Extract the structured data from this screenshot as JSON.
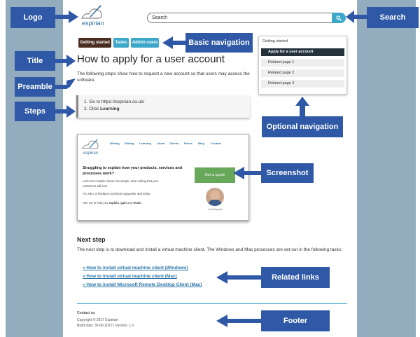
{
  "annotations": {
    "logo": "Logo",
    "search": "Search",
    "basic_nav": "Basic navigation",
    "title": "Title",
    "preamble": "Preamble",
    "steps": "Steps",
    "optional_nav": "Optional navigation",
    "screenshot": "Screenshot",
    "related_links": "Related links",
    "footer": "Footer"
  },
  "brand": {
    "name": "espirian"
  },
  "search": {
    "placeholder": "Search"
  },
  "nav": {
    "getting_started": "Getting started",
    "tasks": "Tasks",
    "admin_users": "Admin users"
  },
  "page": {
    "title": "How to apply for a user account",
    "preamble": "The following steps show how to request a new account so that users may access the software.",
    "steps": [
      "1. Go to https://espirian.co.uk/",
      "2. Click "
    ],
    "step2_bold": "Learning"
  },
  "sidebar": {
    "heading": "Getting started",
    "items": [
      "Apply for a user account",
      "Related page 1",
      "Related page 2",
      "Related page 3"
    ]
  },
  "shot": {
    "nav": [
      "Writing",
      "Editing",
      "Learning",
      "About",
      "Clients",
      "Prices",
      "Blog",
      "Contact"
    ],
    "heading": "Struggling to explain how your products, services and processes work?",
    "p1": "Let's turn complex ideas into simple, clear writing that your customers will love.",
    "p2": "I'm John, a freelance technical copywriter and editor.",
    "p3a": "Hire me to help you ",
    "explain": "explain",
    "comma": ", ",
    "gain": "gain",
    "and": " and ",
    "retain": "retain",
    "dot": ".",
    "button": "Get a quote",
    "caption": "John Espirian"
  },
  "next": {
    "heading": "Next step",
    "text": "The next step is to download and install a virtual machine client. The Windows and Mac processes are set out in the following tasks:",
    "links": [
      "» How to install virtual machine client (Windows)",
      "» How to install virtual machine client (Mac)",
      "» How to install Microsoft Remote Desktop Client (Mac)"
    ]
  },
  "footer": {
    "contact": "Contact us",
    "copyright": "Copyright © 2017 Espirian",
    "build": "Build date: 30-06-2017 | Version: 1.0"
  },
  "colors": {
    "annotation": "#2f59a6",
    "frame": "#93adbf",
    "teal": "#3da7c9",
    "dark": "#4a2d1f"
  }
}
